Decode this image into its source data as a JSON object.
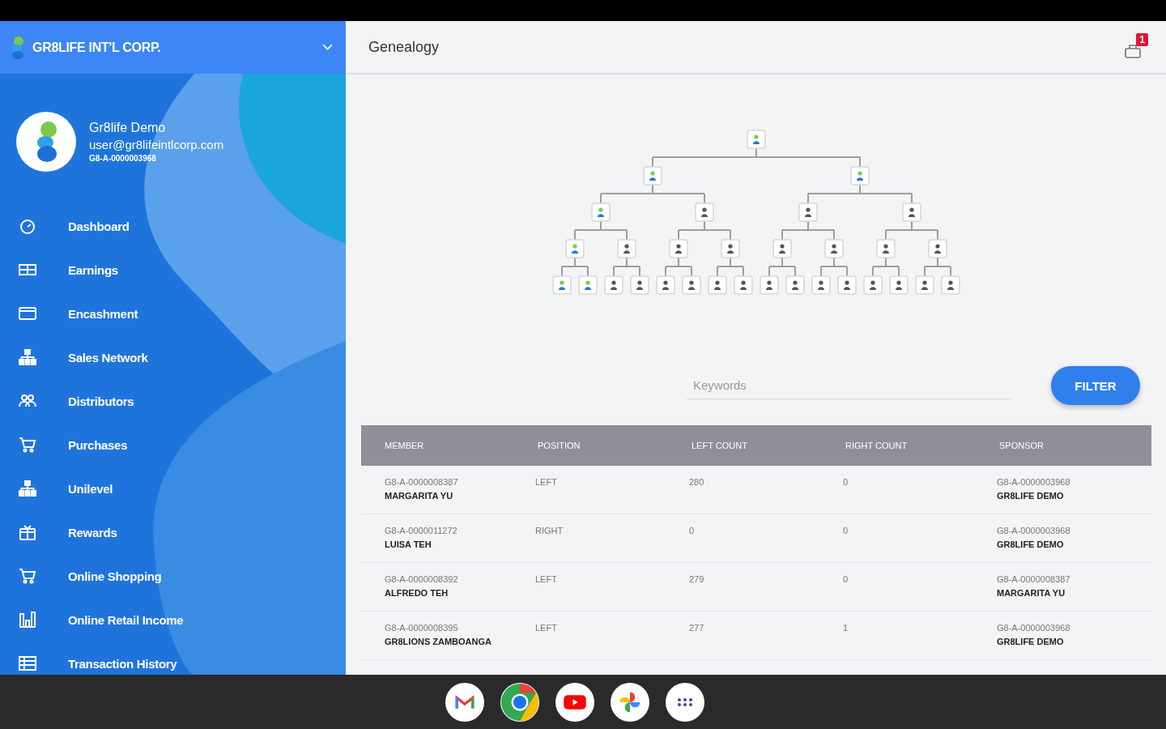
{
  "sidebar": {
    "company": "GR8LIFE INT'L CORP.",
    "profile": {
      "name": "Gr8life Demo",
      "email": "user@gr8lifeintlcorp.com",
      "member_id": "G8-A-0000003968"
    },
    "items": [
      {
        "label": "Dashboard"
      },
      {
        "label": "Earnings"
      },
      {
        "label": "Encashment"
      },
      {
        "label": "Sales Network"
      },
      {
        "label": "Distributors"
      },
      {
        "label": "Purchases"
      },
      {
        "label": "Unilevel"
      },
      {
        "label": "Rewards"
      },
      {
        "label": "Online Shopping"
      },
      {
        "label": "Online Retail Income"
      },
      {
        "label": "Transaction History"
      }
    ]
  },
  "header": {
    "title": "Genealogy",
    "cart_badge": "1"
  },
  "genealogy": {
    "root": {
      "active": true,
      "children": [
        {
          "active": true,
          "children": [
            {
              "active": true,
              "children": [
                {
                  "active": true,
                  "children": [
                    {
                      "active": true
                    },
                    {
                      "active": true
                    }
                  ]
                },
                {
                  "active": false,
                  "children": [
                    {
                      "active": false
                    },
                    {
                      "active": false
                    }
                  ]
                }
              ]
            },
            {
              "active": false,
              "children": [
                {
                  "active": false,
                  "children": [
                    {
                      "active": false
                    },
                    {
                      "active": false
                    }
                  ]
                },
                {
                  "active": false,
                  "children": [
                    {
                      "active": false
                    },
                    {
                      "active": false
                    }
                  ]
                }
              ]
            }
          ]
        },
        {
          "active": true,
          "children": [
            {
              "active": false,
              "children": [
                {
                  "active": false,
                  "children": [
                    {
                      "active": false
                    },
                    {
                      "active": false
                    }
                  ]
                },
                {
                  "active": false,
                  "children": [
                    {
                      "active": false
                    },
                    {
                      "active": false
                    }
                  ]
                }
              ]
            },
            {
              "active": false,
              "children": [
                {
                  "active": false,
                  "children": [
                    {
                      "active": false
                    },
                    {
                      "active": false
                    }
                  ]
                },
                {
                  "active": false,
                  "children": [
                    {
                      "active": false
                    },
                    {
                      "active": false
                    }
                  ]
                }
              ]
            }
          ]
        }
      ]
    }
  },
  "filter": {
    "placeholder": "Keywords",
    "button": "FILTER"
  },
  "table": {
    "columns": [
      "MEMBER",
      "POSITION",
      "LEFT COUNT",
      "RIGHT COUNT",
      "SPONSOR"
    ],
    "rows": [
      {
        "member_id": "G8-A-0000008387",
        "member_name": "MARGARITA YU",
        "position": "LEFT",
        "left_count": "280",
        "right_count": "0",
        "sponsor_id": "G8-A-0000003968",
        "sponsor_name": "GR8LIFE DEMO"
      },
      {
        "member_id": "G8-A-0000011272",
        "member_name": "LUISA TEH",
        "position": "RIGHT",
        "left_count": "0",
        "right_count": "0",
        "sponsor_id": "G8-A-0000003968",
        "sponsor_name": "GR8LIFE DEMO"
      },
      {
        "member_id": "G8-A-0000008392",
        "member_name": "ALFREDO TEH",
        "position": "LEFT",
        "left_count": "279",
        "right_count": "0",
        "sponsor_id": "G8-A-0000008387",
        "sponsor_name": "MARGARITA YU"
      },
      {
        "member_id": "G8-A-0000008395",
        "member_name": "GR8LIONS ZAMBOANGA",
        "position": "LEFT",
        "left_count": "277",
        "right_count": "1",
        "sponsor_id": "G8-A-0000003968",
        "sponsor_name": "GR8LIFE DEMO"
      }
    ]
  }
}
